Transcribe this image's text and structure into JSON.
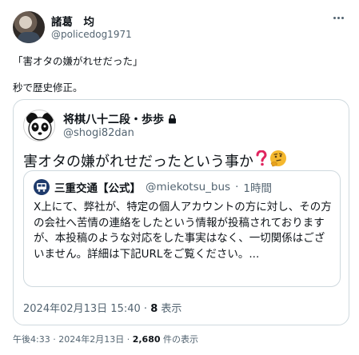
{
  "author": {
    "name": "諸葛　均",
    "handle": "@policedog1971"
  },
  "tweet": {
    "line1": "「害オタの嫌がれせだった」",
    "line2": "秒で歴史修正。"
  },
  "quoted": {
    "name": "将棋八十二段・歩歩",
    "handle": "@shogi82dan",
    "text": "害オタの嫌がれせだったという事か",
    "date": "2024年02月13日 15:40",
    "separator": "·",
    "views_count": "8",
    "views_label": "表示",
    "inner": {
      "name": "三重交通【公式】",
      "handle": "@miekotsu_bus",
      "separator": "·",
      "time": "1時間",
      "body": "X上にて、弊社が、特定の個人アカウントの方に対し、その方の会社へ苦情の連絡をしたという情報が投稿されておりますが、本投稿のような対応をした事実はなく、一切関係はございません。詳細は下記URLをご覧ください。..."
    }
  },
  "footer": {
    "time": "午後4:33",
    "date": "2024年2月13日",
    "separator": "·",
    "views_count": "2,680",
    "views_label": "件の表示"
  },
  "icons": {
    "lock": "lock-icon",
    "question": "red-question-mark-icon",
    "thinking": "thinking-face-icon",
    "more": "more-icon"
  },
  "colors": {
    "text": "#0f1419",
    "secondary": "#536471",
    "border": "#cfd9de",
    "question": "#e0245e",
    "emoji": "#f5b82e"
  }
}
